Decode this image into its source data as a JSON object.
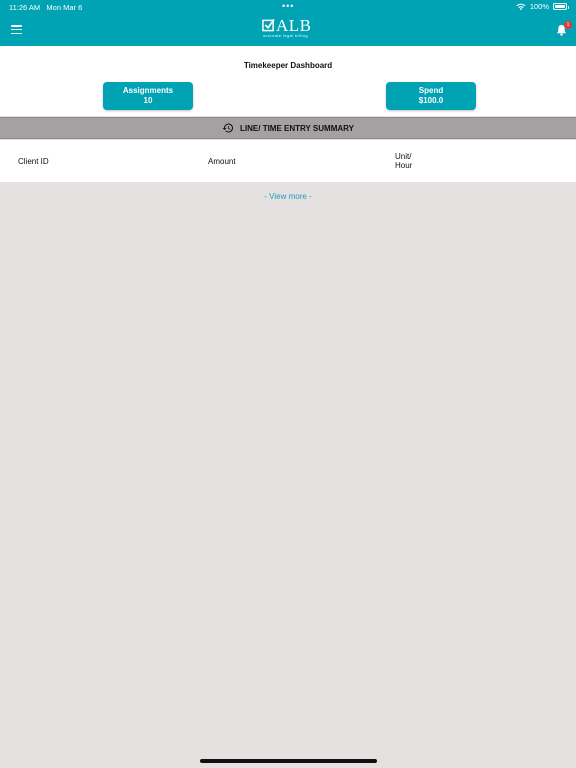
{
  "status_bar": {
    "time": "11:26 AM",
    "date": "Mon Mar 6",
    "dots": "•••",
    "battery": "100%"
  },
  "header": {
    "logo_text": "ALB",
    "logo_tagline": "accurate legal billing",
    "notification_count": "1"
  },
  "dashboard": {
    "title": "Timekeeper Dashboard",
    "assignments": {
      "label": "Assignments",
      "value": "10"
    },
    "spend": {
      "label": "Spend",
      "value": "$100.0"
    }
  },
  "summary": {
    "title": "LINE/ TIME ENTRY SUMMARY",
    "columns": [
      "Client ID",
      "Amount",
      "Unit/\nHour"
    ],
    "view_more": "- View more -"
  },
  "colors": {
    "brand": "#00a3b4",
    "background": "#e5e1e0",
    "summary_bar": "#a5a1a0",
    "badge": "#e53935"
  }
}
